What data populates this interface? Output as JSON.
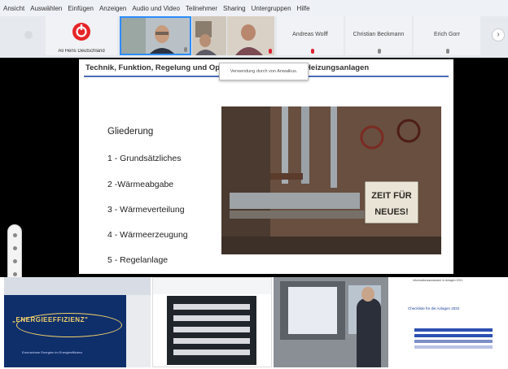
{
  "menu": {
    "items": [
      "Ansicht",
      "Auswählen",
      "Einfügen",
      "Anzeigen",
      "Audio und Video",
      "Teilnehmer",
      "Sharing",
      "Untergruppen",
      "Hilfe"
    ]
  },
  "participants": {
    "tiles": [
      {
        "name": "Ali Hens   Deutschland",
        "kind": "logo"
      },
      {
        "name": "",
        "kind": "video-man"
      },
      {
        "name": "",
        "kind": "video-room"
      },
      {
        "name": "",
        "kind": "video-small"
      },
      {
        "name": "Andreas Wolff",
        "kind": "name"
      },
      {
        "name": "Christian Beckmann",
        "kind": "name"
      },
      {
        "name": "Erich Gorr",
        "kind": "name"
      }
    ],
    "next_arrow": "›"
  },
  "shared_screen": {
    "slide_title": "Technik, Funktion, Regelung und Optimierung bestehender Heizungsanlagen",
    "tooltip": "Verwendung durch von Anwalkus.",
    "agenda_heading": "Gliederung",
    "agenda_items": [
      "1 - Grundsätzliches",
      "2 -Wärmeabgabe",
      "3 - Wärmeverteilung",
      "4 - Wärmeerzeugung",
      "5 - Regelanlage"
    ],
    "photo_sign": [
      "ZEIT FÜR",
      "NEUES!"
    ]
  },
  "thumbnails": [
    {
      "label": "„ENERGIEEFFIZIENZ\"",
      "subtitle": "Erneuerbare Energien im Energieeffizienz"
    },
    {
      "label": ""
    },
    {
      "label": ""
    },
    {
      "caption": "Informationsaustausch in Anlagen 2021",
      "title": "Checkliste für die Anlagen 2022"
    }
  ],
  "colors": {
    "accent": "#4b6cb7",
    "thumb1_bg": "#0f2f6b",
    "logo_red": "#e52528"
  }
}
